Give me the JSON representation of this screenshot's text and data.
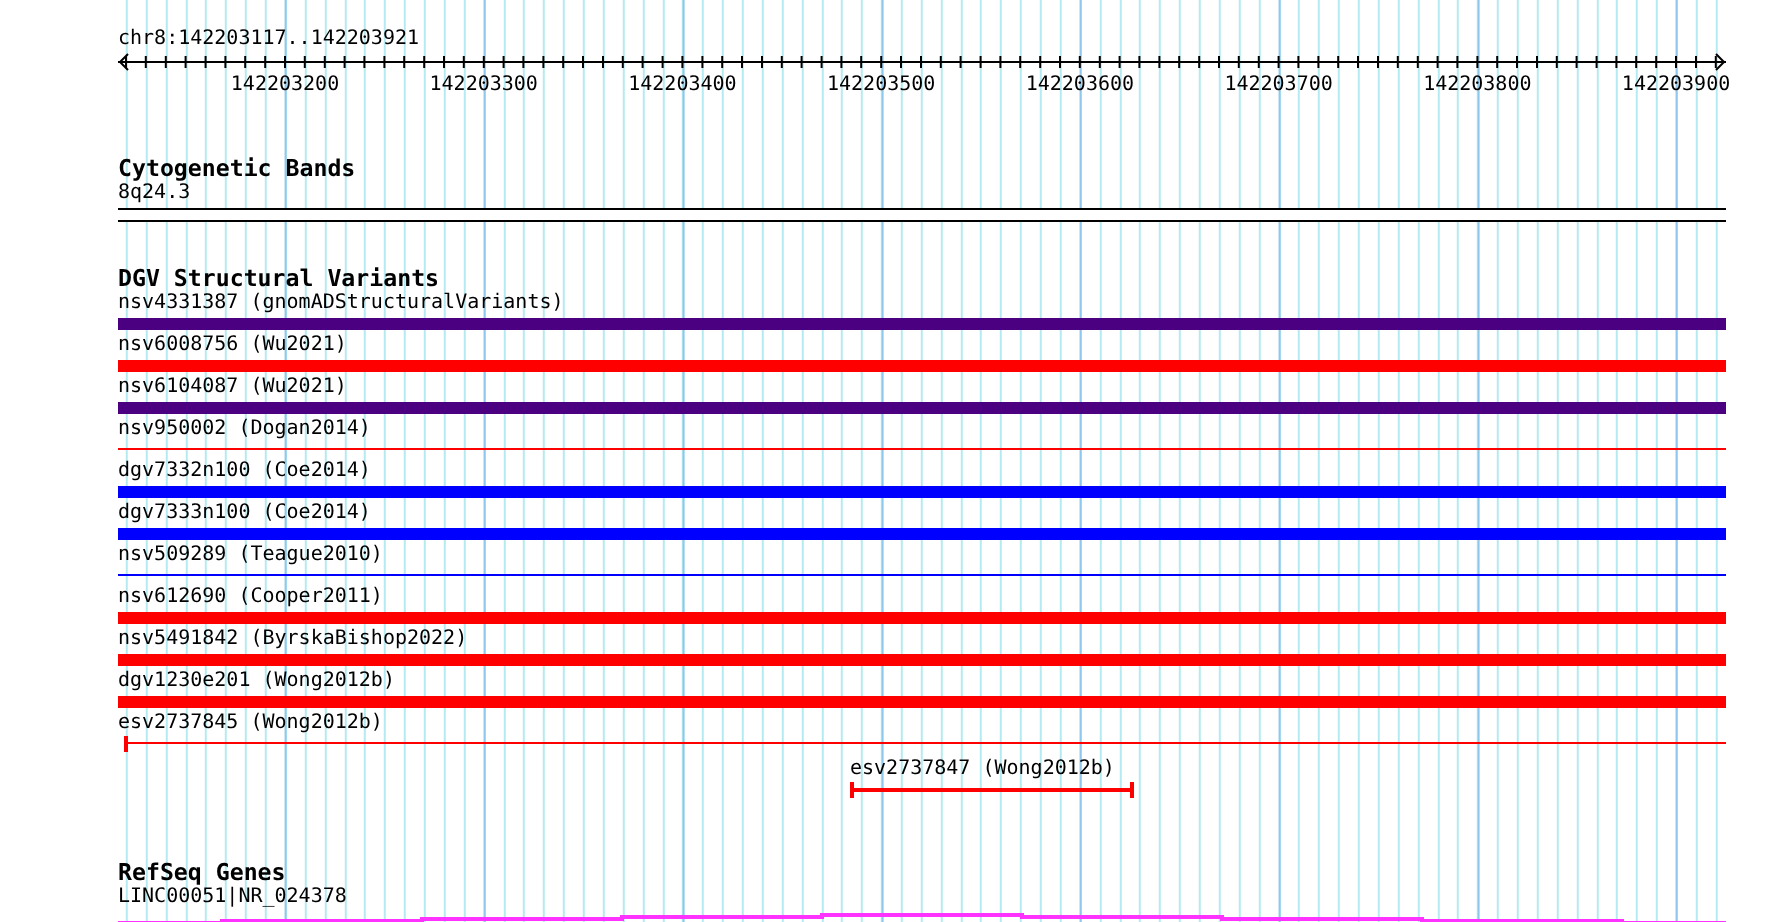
{
  "location": "chr8:142203117..142203921",
  "ruler": {
    "labels": [
      "142203200",
      "142203300",
      "142203400",
      "142203500",
      "142203600",
      "142203700",
      "142203800",
      "142203900"
    ]
  },
  "tracks": [
    {
      "kind": "bands",
      "title": "Cytogenetic Bands",
      "features": [
        {
          "label": "8q24.3"
        }
      ]
    },
    {
      "kind": "variants",
      "title": "DGV Structural Variants",
      "features": [
        {
          "label": "nsv4331387 (gnomADStructuralVariants)",
          "kind": "thick",
          "color": "#4b0082"
        },
        {
          "label": "nsv6008756 (Wu2021)",
          "kind": "thick",
          "color": "#ff0000"
        },
        {
          "label": "nsv6104087 (Wu2021)",
          "kind": "thick",
          "color": "#4b0082"
        },
        {
          "label": "nsv950002 (Dogan2014)",
          "kind": "thin",
          "color": "#ff0000"
        },
        {
          "label": "dgv7332n100 (Coe2014)",
          "kind": "thick",
          "color": "#0000ff"
        },
        {
          "label": "dgv7333n100 (Coe2014)",
          "kind": "thick",
          "color": "#0000ff"
        },
        {
          "label": "nsv509289 (Teague2010)",
          "kind": "thin",
          "color": "#0000ff"
        },
        {
          "label": "nsv612690 (Cooper2011)",
          "kind": "thick",
          "color": "#ff0000"
        },
        {
          "label": "nsv5491842 (ByrskaBishop2022)",
          "kind": "thick",
          "color": "#ff0000"
        },
        {
          "label": "dgv1230e201 (Wong2012b)",
          "kind": "thick",
          "color": "#ff0000"
        },
        {
          "label": "esv2737845 (Wong2012b)",
          "kind": "start",
          "color": "#ff0000"
        },
        {
          "label": "esv2737847 (Wong2012b)",
          "kind": "short",
          "color": "#ff0000"
        }
      ]
    },
    {
      "kind": "genes",
      "title": "RefSeq Genes",
      "features": [
        {
          "label": "LINC00051|NR_024378"
        }
      ]
    }
  ]
}
